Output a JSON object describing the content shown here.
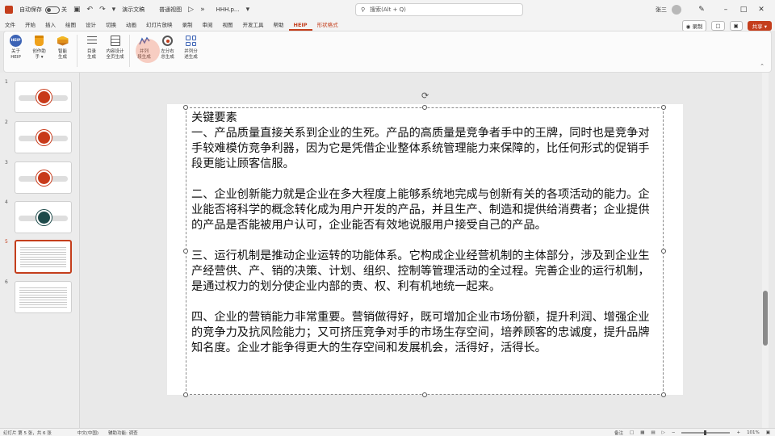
{
  "titlebar": {
    "autosave_label": "自动保存",
    "autosave_state": "关",
    "file_name": "演示文稿",
    "view_mode": "普通视图",
    "doc_name": "HHH.p...",
    "search_placeholder": "搜索(Alt + Q)",
    "user_name": "张三"
  },
  "menu": {
    "tabs": [
      "文件",
      "开始",
      "插入",
      "绘图",
      "设计",
      "切换",
      "动画",
      "幻灯片放映",
      "录制",
      "审阅",
      "视图",
      "开发工具",
      "帮助",
      "HEIP",
      "形状格式"
    ],
    "active_index": 13,
    "special_index": 14,
    "record_label": "录制",
    "share_label": "共享"
  },
  "ribbon": {
    "buttons": [
      {
        "l1": "关于",
        "l2": "HEIP",
        "icon": "help-icon"
      },
      {
        "l1": "创作助",
        "l2": "手 ▾",
        "icon": "cup-icon"
      },
      {
        "l1": "智能",
        "l2": "生成",
        "icon": "layers-icon"
      },
      {
        "l1": "目录",
        "l2": "生成",
        "icon": "list-icon"
      },
      {
        "l1": "内容设计",
        "l2": "全页生成",
        "icon": "document-icon"
      },
      {
        "l1": "并列",
        "l2": "段生成",
        "icon": "wave-icon"
      },
      {
        "l1": "左分右",
        "l2": "总生成",
        "icon": "target-icon"
      },
      {
        "l1": "并列分",
        "l2": "述生成",
        "icon": "grid-icon"
      }
    ]
  },
  "thumbnails": {
    "numbers": [
      "1",
      "2",
      "3",
      "4",
      "5",
      "6"
    ],
    "selected_index": 4
  },
  "slide": {
    "heading": "关键要素",
    "paragraphs": [
      "一、产品质量直接关系到企业的生死。产品的高质量是竞争者手中的王牌，同时也是竞争对手较难模仿竞争利器，因为它是凭借企业整体系统管理能力来保障的，比任何形式的促销手段更能让顾客信服。",
      "二、企业创新能力就是企业在多大程度上能够系统地完成与创新有关的各项活动的能力。企业能否将科学的概念转化成为用户开发的产品，并且生产、制造和提供给消费者；企业提供的产品是否能被用户认可，企业能否有效地说服用户接受自己的产品。",
      "三、运行机制是推动企业运转的功能体系。它构成企业经营机制的主体部分，涉及到企业生产经营供、产、销的决策、计划、组织、控制等管理活动的全过程。完善企业的运行机制，是通过权力的划分使企业内部的责、权、利有机地统一起来。",
      "四、企业的营销能力非常重要。营销做得好，既可增加企业市场份额，提升利润、增强企业的竞争力及抗风险能力；又可挤压竞争对手的市场生存空间，培养顾客的忠诚度，提升品牌知名度。企业才能争得更大的生存空间和发展机会，活得好，活得长。"
    ]
  },
  "statusbar": {
    "slide_info": "幻灯片 第 5 张，共 6 张",
    "language": "中文(中国)",
    "accessibility": "辅助功能: 调查",
    "notes_label": "备注",
    "zoom": "101%"
  }
}
